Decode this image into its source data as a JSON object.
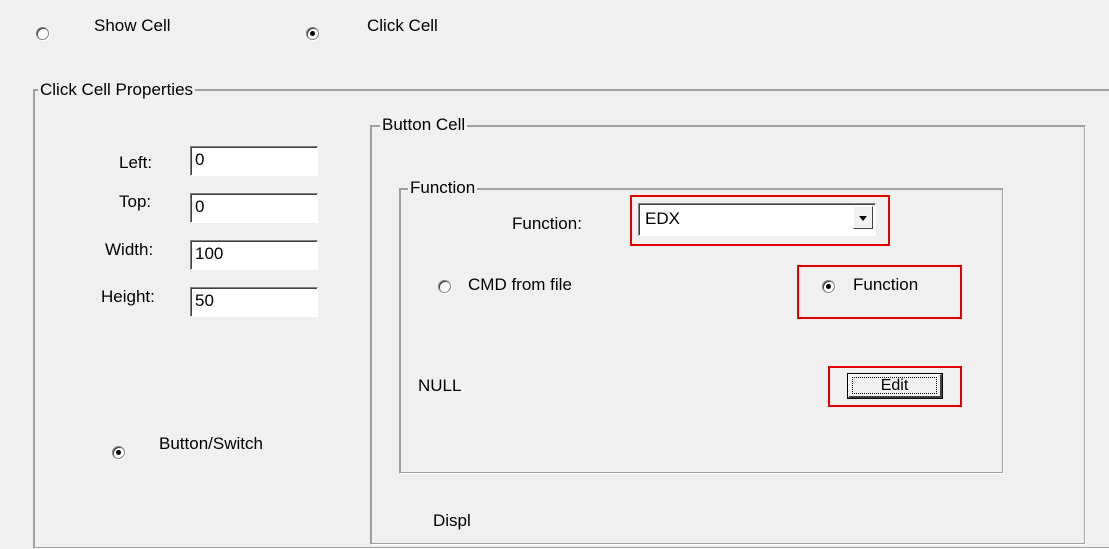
{
  "mode": {
    "show_cell": "Show Cell",
    "click_cell": "Click Cell"
  },
  "click_cell_properties": {
    "title": "Click Cell Properties",
    "left_label": "Left:",
    "left_value": "0",
    "top_label": "Top:",
    "top_value": "0",
    "width_label": "Width:",
    "width_value": "100",
    "height_label": "Height:",
    "height_value": "50",
    "button_switch_label": "Button/Switch"
  },
  "button_cell": {
    "title": "Button Cell",
    "function_group": {
      "title": "Function",
      "function_label": "Function:",
      "function_value": "EDX",
      "cmd_from_file_label": "CMD from file",
      "function_radio_label": "Function",
      "null_text": "NULL",
      "edit_label": "Edit"
    },
    "display_partial": "Displ"
  },
  "colors": {
    "highlight": "#e00000",
    "background": "#f0f0f0"
  }
}
